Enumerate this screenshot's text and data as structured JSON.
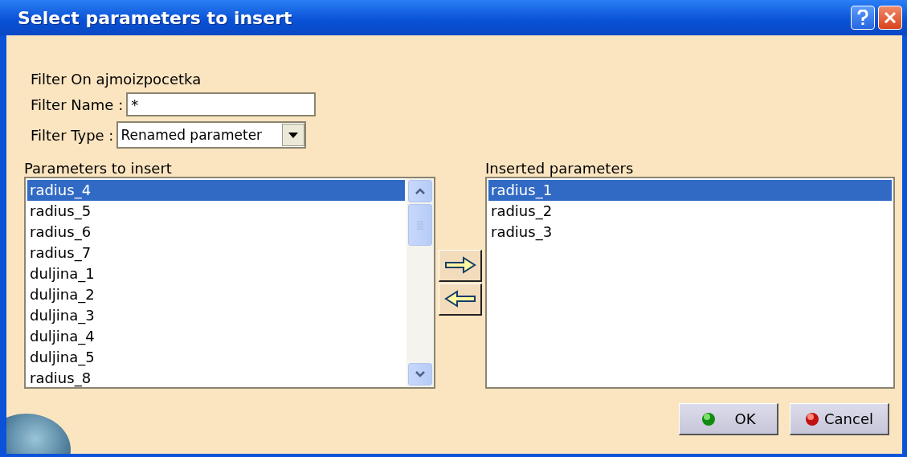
{
  "window": {
    "title": "Select parameters to insert"
  },
  "filter_on": "Filter On ajmoizpocetka",
  "filter_name": {
    "label": "Filter Name :",
    "value": "*"
  },
  "filter_type": {
    "label": "Filter Type :",
    "value": "Renamed parameter"
  },
  "parameters_to_insert": {
    "label": "Parameters to insert",
    "items": [
      {
        "text": "radius_4",
        "selected": true
      },
      {
        "text": "radius_5",
        "selected": false
      },
      {
        "text": "radius_6",
        "selected": false
      },
      {
        "text": "radius_7",
        "selected": false
      },
      {
        "text": "duljina_1",
        "selected": false
      },
      {
        "text": "duljina_2",
        "selected": false
      },
      {
        "text": "duljina_3",
        "selected": false
      },
      {
        "text": "duljina_4",
        "selected": false
      },
      {
        "text": "duljina_5",
        "selected": false
      },
      {
        "text": "radius_8",
        "selected": false
      }
    ]
  },
  "inserted_parameters": {
    "label": "Inserted parameters",
    "items": [
      {
        "text": "radius_1",
        "selected": true
      },
      {
        "text": "radius_2",
        "selected": false
      },
      {
        "text": "radius_3",
        "selected": false
      }
    ]
  },
  "buttons": [
    {
      "label": "OK",
      "kind": "ok"
    },
    {
      "label": "Cancel",
      "kind": "cancel"
    }
  ]
}
